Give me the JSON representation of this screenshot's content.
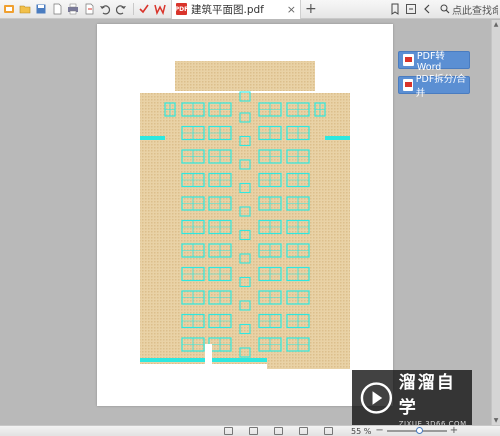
{
  "toolbar": {
    "icons": [
      "logo-icon",
      "open-icon",
      "save-icon",
      "new-icon",
      "print-icon",
      "export-icon",
      "undo-icon",
      "redo-icon",
      "check-icon",
      "wps-icon"
    ]
  },
  "tab": {
    "badge": "PDF",
    "title": "建筑平面图.pdf",
    "close": "×",
    "new_tab": "+"
  },
  "search": {
    "placeholder": "点此查找命令"
  },
  "side_buttons": {
    "pdf_to_word": "PDF转Word",
    "pdf_split_merge": "PDF拆分/合并"
  },
  "status": {
    "zoom_percent": "55 %",
    "zoom_minus": "−",
    "zoom_plus": "+",
    "zoom_fraction": 0.55
  },
  "watermark": {
    "title": "溜溜自学",
    "url": "ZIXUE.3D66.COM"
  },
  "colors": {
    "building_fill": "#e8cfa0",
    "window_cyan": "#2ee8e0",
    "accent_blue": "#5b8fd3",
    "pdf_red": "#d9342b"
  }
}
